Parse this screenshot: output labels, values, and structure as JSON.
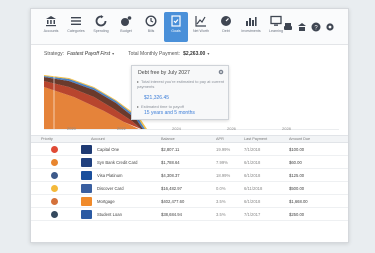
{
  "toolbar": {
    "items": [
      {
        "label": "Accounts",
        "icon": "bank-icon"
      },
      {
        "label": "Categories",
        "icon": "list-icon"
      },
      {
        "label": "Spending",
        "icon": "refresh-icon"
      },
      {
        "label": "Budget",
        "icon": "jar-icon"
      },
      {
        "label": "Bills",
        "icon": "clock-icon"
      },
      {
        "label": "Goals",
        "icon": "flag-icon"
      },
      {
        "label": "Net Worth",
        "icon": "line-chart-icon"
      },
      {
        "label": "Debt",
        "icon": "gauge-icon"
      },
      {
        "label": "Investments",
        "icon": "bar-chart-icon"
      },
      {
        "label": "Learning",
        "icon": "monitor-icon"
      }
    ],
    "active_index": 5,
    "right_icons": [
      "print-icon",
      "account-icon",
      "help-icon",
      "settings-icon"
    ]
  },
  "strategy": {
    "label": "Strategy:",
    "value": "Fastest Payoff First",
    "total_label": "Total Monthly Payment:",
    "total_value": "$2,263.00"
  },
  "tooltip": {
    "title": "Debt free by July 2027",
    "interest_label": "Total interest you're estimated to pay at current payments",
    "interest_value": "$21,326.45",
    "time_label": "Estimated time to payoff",
    "time_value": "15 years and 5 months"
  },
  "chart": {
    "x_ticks": [
      "2020",
      "2022",
      "2024",
      "2026",
      "2028"
    ],
    "colors": {
      "orange": "#e5833a",
      "dark_orange": "#c85a2e",
      "red": "#b8452e",
      "blue": "#4a82c4",
      "yellow": "#f2c04a"
    }
  },
  "table": {
    "headers": [
      "Priority",
      "Account",
      "Balance",
      "APR",
      "Last Payment",
      "Amount Due"
    ],
    "rows": [
      {
        "dot": "#e04a35",
        "logo": "#1e3a73",
        "account": "Capital One",
        "balance": "$2,807.11",
        "apr": "19.99%",
        "last": "7/1/2018",
        "due": "$100.00"
      },
      {
        "dot": "#e8852e",
        "logo": "#20407e",
        "account": "Syn Bank Credit Card",
        "balance": "$1,788.64",
        "apr": "7.99%",
        "last": "6/1/2018",
        "due": "$60.00"
      },
      {
        "dot": "#3d5a8a",
        "logo": "#1a4f9c",
        "account": "Visa Platinum",
        "balance": "$4,308.37",
        "apr": "18.99%",
        "last": "6/1/2018",
        "due": "$125.00"
      },
      {
        "dot": "#f4b93a",
        "logo": "#3a5fa0",
        "account": "Discover Card",
        "balance": "$16,482.97",
        "apr": "0.0%",
        "last": "6/11/2018",
        "due": "$500.00"
      },
      {
        "dot": "#d4713a",
        "logo": "#f08a2a",
        "account": "Mortgage",
        "balance": "$402,477.60",
        "apr": "3.5%",
        "last": "6/1/2018",
        "due": "$1,668.00"
      },
      {
        "dot": "#34495e",
        "logo": "#2b5aa3",
        "account": "Student Loan",
        "balance": "$38,684.94",
        "apr": "3.5%",
        "last": "7/1/2017",
        "due": "$250.00"
      }
    ]
  }
}
